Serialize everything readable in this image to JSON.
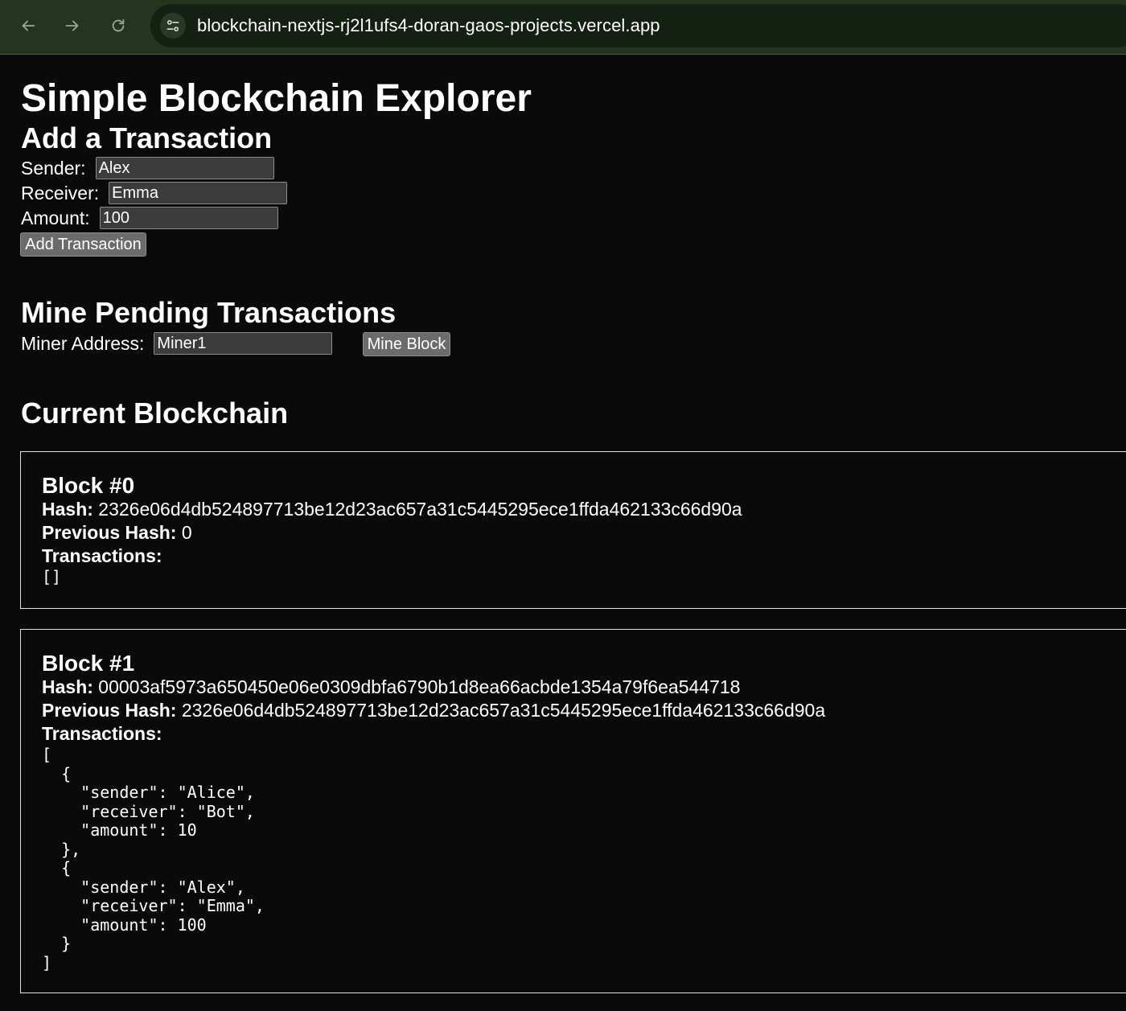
{
  "browser": {
    "url": "blockchain-nextjs-rj2l1ufs4-doran-gaos-projects.vercel.app",
    "icons": [
      "back-arrow-icon",
      "forward-arrow-icon",
      "reload-icon",
      "site-settings-icon"
    ]
  },
  "page": {
    "title": "Simple Blockchain Explorer",
    "add_section": {
      "heading": "Add a Transaction",
      "sender_label": "Sender:",
      "sender_value": "Alex",
      "receiver_label": "Receiver:",
      "receiver_value": "Emma",
      "amount_label": "Amount:",
      "amount_value": "100",
      "button_label": "Add Transaction"
    },
    "mine_section": {
      "heading": "Mine Pending Transactions",
      "miner_label": "Miner Address:",
      "miner_value": "Miner1",
      "button_label": "Mine Block"
    },
    "chain_section": {
      "heading": "Current Blockchain",
      "hash_label": "Hash:",
      "prev_hash_label": "Previous Hash:",
      "transactions_label": "Transactions:",
      "blocks": [
        {
          "title": "Block #0",
          "hash": "2326e06d4db524897713be12d23ac657a31c5445295ece1ffda462133c66d90a",
          "previous_hash": "0",
          "transactions": "[]"
        },
        {
          "title": "Block #1",
          "hash": "00003af5973a650450e06e0309dbfa6790b1d8ea66acbde1354a79f6ea544718",
          "previous_hash": "2326e06d4db524897713be12d23ac657a31c5445295ece1ffda462133c66d90a",
          "transactions": "[\n  {\n    \"sender\": \"Alice\",\n    \"receiver\": \"Bot\",\n    \"amount\": 10\n  },\n  {\n    \"sender\": \"Alex\",\n    \"receiver\": \"Emma\",\n    \"amount\": 100\n  }\n]"
        }
      ]
    }
  }
}
